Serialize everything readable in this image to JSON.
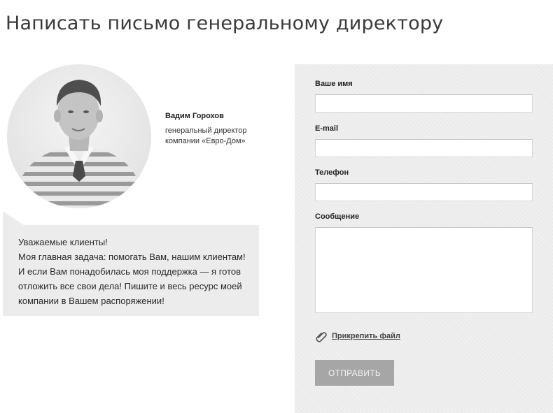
{
  "page": {
    "title": "Написать письмо генеральному директору"
  },
  "director": {
    "name": "Вадим Горохов",
    "role": "генеральный директор\nкомпании «Евро-Дом»",
    "message": "Уважаемые клиенты!\nМоя главная задача: помогать Вам, нашим клиентам!\nИ если Вам понадобилась моя поддержка — я готов\nотложить все свои дела! Пишите и весь ресурс моей\nкомпании в Вашем распоряжении!"
  },
  "form": {
    "fields": {
      "name": {
        "label": "Ваше имя",
        "value": ""
      },
      "email": {
        "label": "E-mail",
        "value": ""
      },
      "phone": {
        "label": "Телефон",
        "value": ""
      },
      "message": {
        "label": "Сообщение",
        "value": ""
      }
    },
    "attach_label": "Прикрепить файл",
    "attach_icon": "paperclip-icon",
    "submit_label": "ОТПРАВИТЬ"
  },
  "colors": {
    "panel_bg": "#f0f0f0",
    "bubble_bg": "#ececec",
    "button_bg": "#a6a6a6"
  }
}
